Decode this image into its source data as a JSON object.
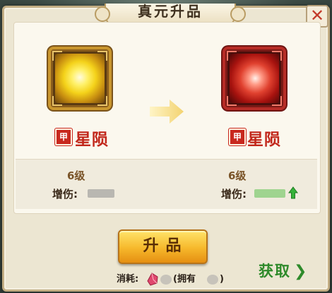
{
  "dialog": {
    "title": "真元升品",
    "close_icon": "close-icon",
    "accent_color": "#c2281c"
  },
  "current": {
    "icon": "golden-star-orb-icon",
    "grade_badge": "甲",
    "name": "星陨",
    "level": "6级",
    "stat_label": "增伤:"
  },
  "next": {
    "icon": "crimson-star-orb-icon",
    "grade_badge": "甲",
    "name": "星陨",
    "level": "6级",
    "stat_label": "增伤:",
    "increase_icon": "green-up-arrow-icon"
  },
  "transition_icon": "right-arrow-icon",
  "upgrade_button": {
    "label": "升品"
  },
  "cost": {
    "label": "消耗:",
    "item_icon": "pink-crystal-icon",
    "owned_label": "(拥有",
    "close_paren": ")"
  },
  "obtain": {
    "label": "获取",
    "icon": "chevron-right-icon"
  }
}
